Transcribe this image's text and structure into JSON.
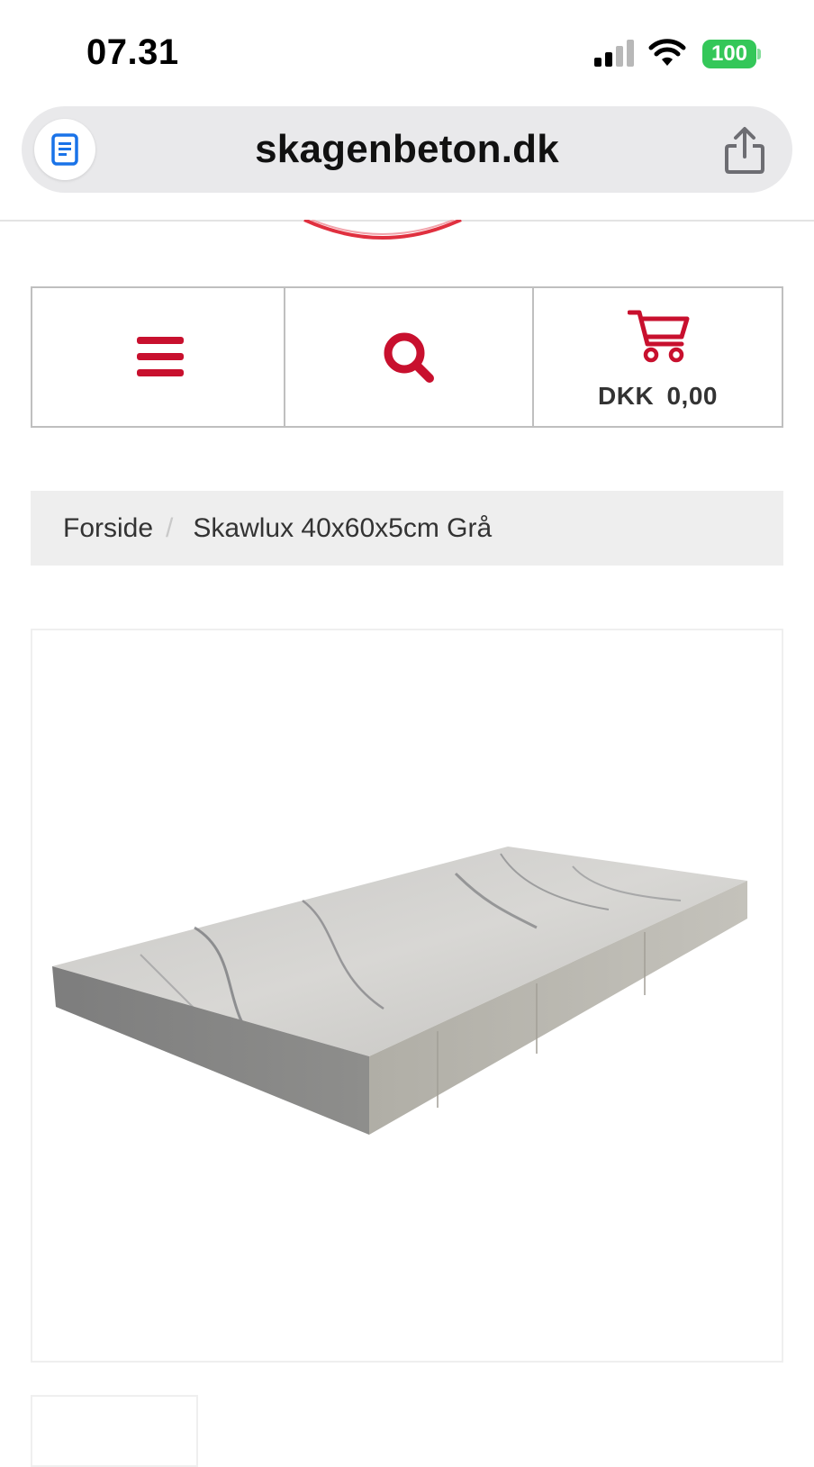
{
  "status_bar": {
    "time": "07.31",
    "battery": "100",
    "icons": [
      "signal-icon",
      "wifi-icon",
      "battery-icon"
    ]
  },
  "browser": {
    "url": "skagenbeton.dk",
    "icons": [
      "reader-icon",
      "share-icon"
    ]
  },
  "nav": {
    "menu_icon": "hamburger-menu-icon",
    "search_icon": "search-icon",
    "cart_icon": "shopping-cart-icon",
    "cart_total": "DKK  0,00"
  },
  "breadcrumb": {
    "home": "Forside",
    "separator": "/",
    "current": "Skawlux 40x60x5cm Grå"
  },
  "product": {
    "image": "concrete-paving-slab-image"
  },
  "colors": {
    "accent": "#c8102e",
    "battery": "#34c759",
    "breadcrumb_bg": "#eeeeee"
  }
}
